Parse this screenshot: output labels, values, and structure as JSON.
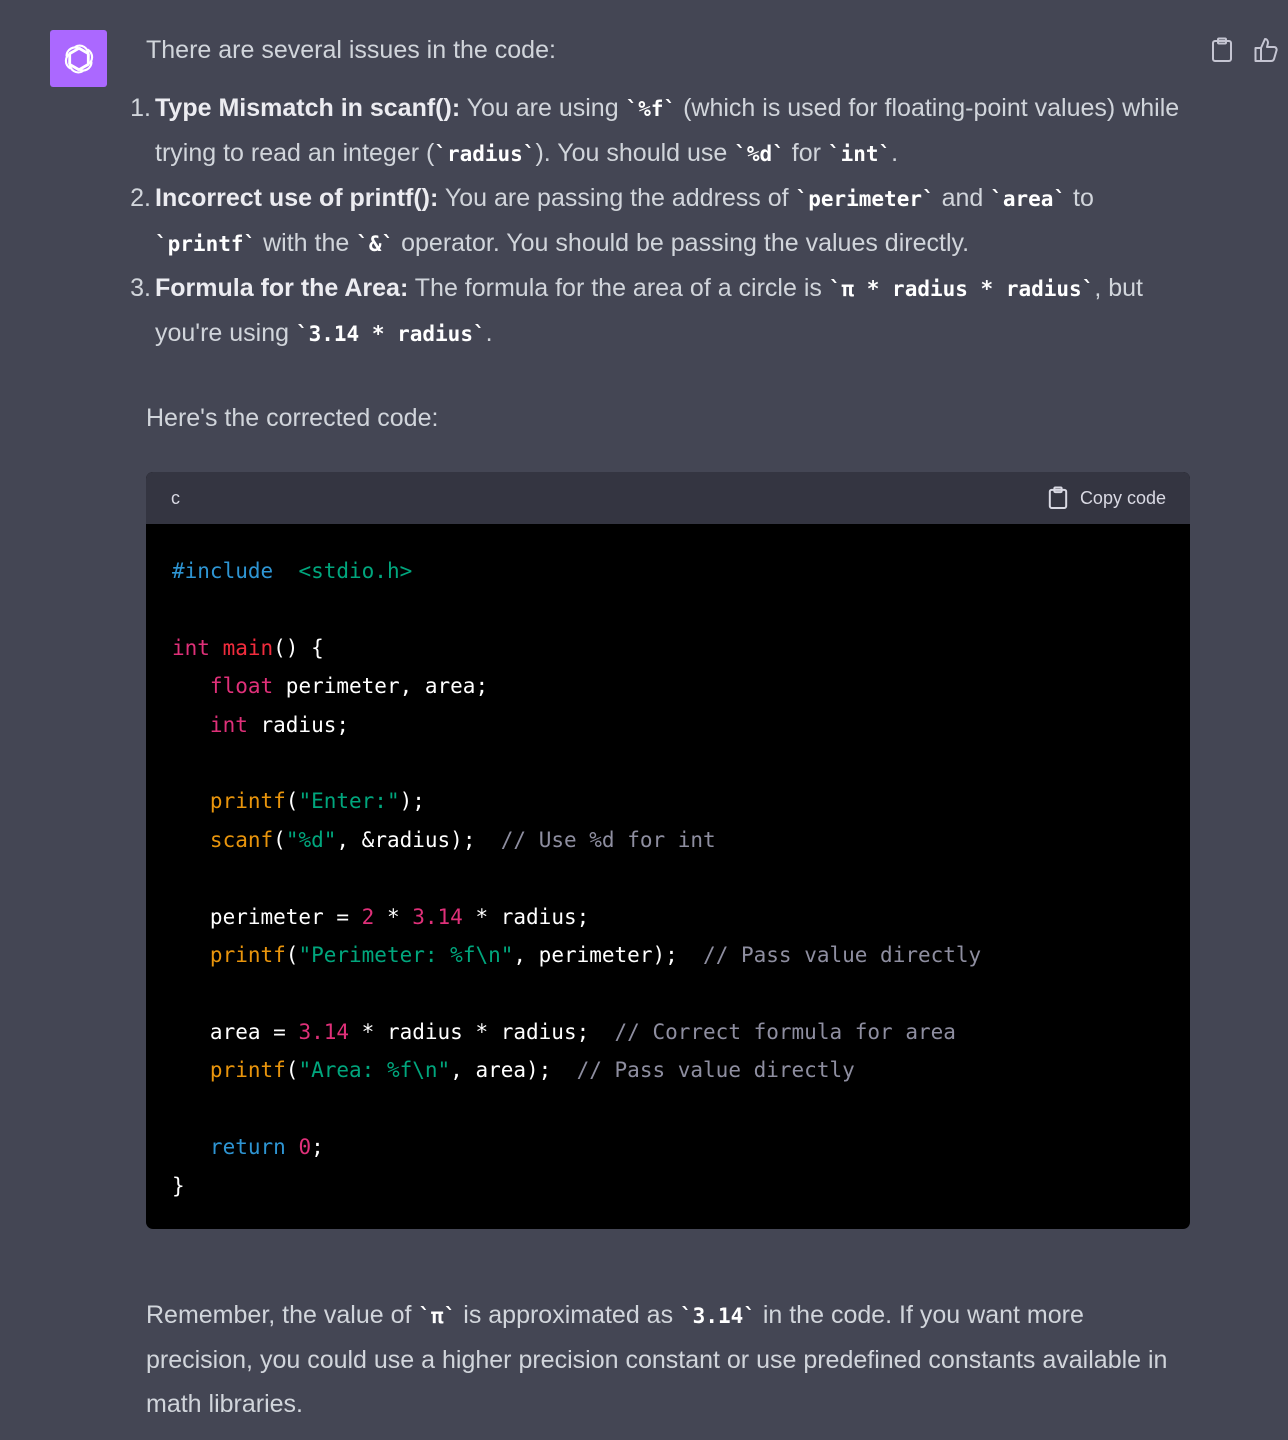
{
  "message": {
    "intro": "There are several issues in the code:",
    "items": [
      {
        "n": "1.",
        "title": "Type Mismatch in scanf():",
        "parts": [
          {
            "t": "text",
            "v": " You are using "
          },
          {
            "t": "code",
            "v": "`%f`"
          },
          {
            "t": "text",
            "v": " (which is used for floating-point values) while trying to read an integer ("
          },
          {
            "t": "code",
            "v": "`radius`"
          },
          {
            "t": "text",
            "v": "). You should use "
          },
          {
            "t": "code",
            "v": "`%d`"
          },
          {
            "t": "text",
            "v": " for "
          },
          {
            "t": "code",
            "v": "`int`"
          },
          {
            "t": "text",
            "v": "."
          }
        ]
      },
      {
        "n": "2.",
        "title": "Incorrect use of printf():",
        "parts": [
          {
            "t": "text",
            "v": " You are passing the address of "
          },
          {
            "t": "code",
            "v": "`perimeter`"
          },
          {
            "t": "text",
            "v": " and "
          },
          {
            "t": "code",
            "v": "`area`"
          },
          {
            "t": "text",
            "v": " to "
          },
          {
            "t": "code",
            "v": "`printf`"
          },
          {
            "t": "text",
            "v": " with the "
          },
          {
            "t": "code",
            "v": "`&`"
          },
          {
            "t": "text",
            "v": " operator. You should be passing the values directly."
          }
        ]
      },
      {
        "n": "3.",
        "title": "Formula for the Area:",
        "parts": [
          {
            "t": "text",
            "v": " The formula for the area of a circle is "
          },
          {
            "t": "code",
            "v": "`π * radius * radius`"
          },
          {
            "t": "text",
            "v": ", but you're using "
          },
          {
            "t": "code",
            "v": "`3.14 * radius`"
          },
          {
            "t": "text",
            "v": "."
          }
        ]
      }
    ],
    "lead": "Here's the corrected code:",
    "outro": [
      {
        "t": "text",
        "v": "Remember, the value of "
      },
      {
        "t": "code",
        "v": "`π`"
      },
      {
        "t": "text",
        "v": " is approximated as "
      },
      {
        "t": "code",
        "v": "`3.14`"
      },
      {
        "t": "text",
        "v": " in the code. If you want more precision, you could use a higher precision constant or use predefined constants available in math libraries."
      }
    ]
  },
  "codeblock": {
    "language": "c",
    "copy_label": "Copy code",
    "lines": [
      [
        [
          "kw",
          "#include"
        ],
        [
          "",
          "  "
        ],
        [
          "str",
          "<stdio.h>"
        ]
      ],
      [],
      [
        [
          "ty",
          "int"
        ],
        [
          "",
          ""
        ],
        [
          "fn",
          " main"
        ],
        [
          "",
          "() {"
        ]
      ],
      [
        [
          "",
          ""
        ],
        [
          "ty",
          "   float"
        ],
        [
          "",
          " perimeter, area;"
        ]
      ],
      [
        [
          "ty",
          "   int"
        ],
        [
          "",
          " radius;"
        ]
      ],
      [],
      [
        [
          "call",
          "   printf"
        ],
        [
          "",
          "("
        ],
        [
          "str",
          "\"Enter:\""
        ],
        [
          "",
          ");"
        ]
      ],
      [
        [
          "call",
          "   scanf"
        ],
        [
          "",
          "("
        ],
        [
          "str",
          "\"%d\""
        ],
        [
          "",
          ", &radius);  "
        ],
        [
          "cm",
          "// Use %d for int"
        ]
      ],
      [],
      [
        [
          "",
          "   perimeter = "
        ],
        [
          "num",
          "2"
        ],
        [
          "",
          " * "
        ],
        [
          "num",
          "3.14"
        ],
        [
          "",
          " * radius;"
        ]
      ],
      [
        [
          "call",
          "   printf"
        ],
        [
          "",
          "("
        ],
        [
          "str",
          "\"Perimeter: %f\\n\""
        ],
        [
          "",
          ", perimeter);  "
        ],
        [
          "cm",
          "// Pass value directly"
        ]
      ],
      [],
      [
        [
          "",
          "   area = "
        ],
        [
          "num",
          "3.14"
        ],
        [
          "",
          " * radius * radius;  "
        ],
        [
          "cm",
          "// Correct formula for area"
        ]
      ],
      [
        [
          "call",
          "   printf"
        ],
        [
          "",
          "("
        ],
        [
          "str",
          "\"Area: %f\\n\""
        ],
        [
          "",
          ", area);  "
        ],
        [
          "cm",
          "// Pass value directly"
        ]
      ],
      [],
      [
        [
          "kw",
          "   return"
        ],
        [
          "num",
          " 0"
        ],
        [
          "",
          ";"
        ]
      ],
      [
        [
          "",
          "}"
        ]
      ]
    ]
  },
  "colors": {
    "background": "#444654",
    "avatar": "#ab68ff",
    "code_bg": "#000000",
    "code_header": "#343541"
  },
  "icons": {
    "avatar": "openai-logo-icon",
    "copy_message": "clipboard-icon",
    "like": "thumbs-up-icon",
    "copy_code": "clipboard-icon"
  }
}
